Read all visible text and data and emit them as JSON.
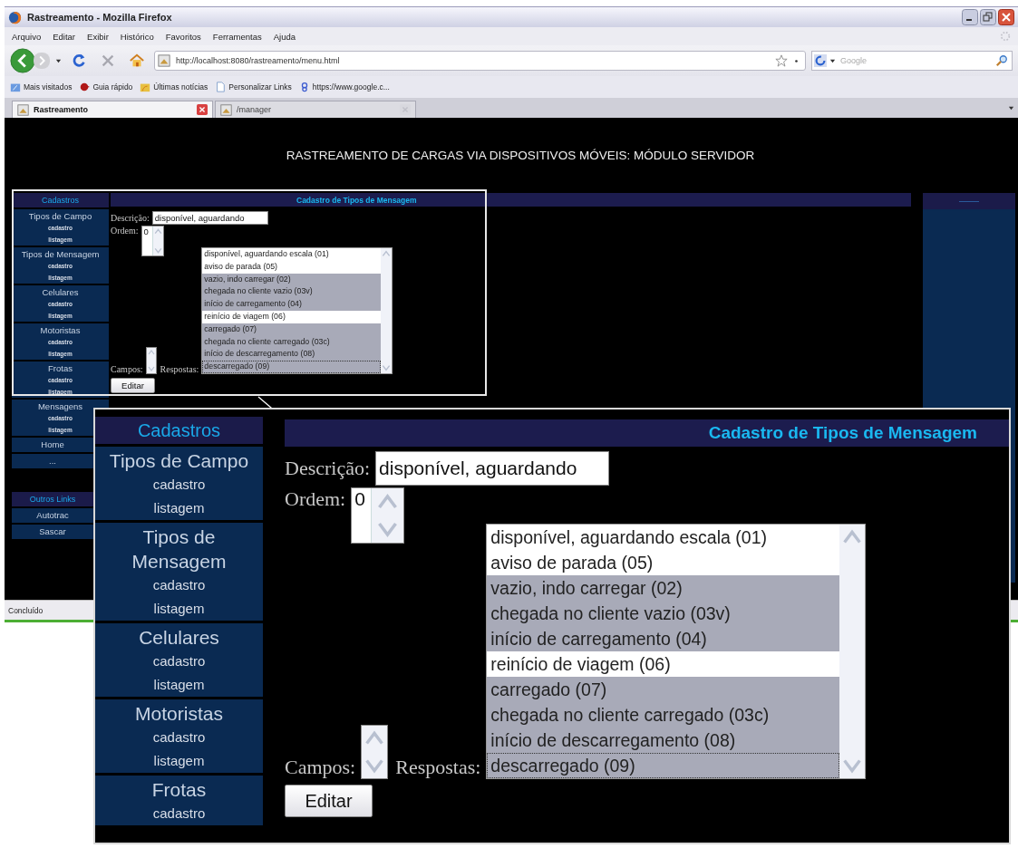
{
  "window": {
    "title": "Rastreamento - Mozilla Firefox"
  },
  "menu": [
    "Arquivo",
    "Editar",
    "Exibir",
    "Histórico",
    "Favoritos",
    "Ferramentas",
    "Ajuda"
  ],
  "navigation": {
    "url": "http://localhost:8080/rastreamento/menu.html",
    "search_placeholder": "Google"
  },
  "bookmarks": [
    {
      "label": "Mais visitados",
      "kind": "smart"
    },
    {
      "label": "Guia rápido",
      "kind": "guide"
    },
    {
      "label": "Últimas notícias",
      "kind": "feed"
    },
    {
      "label": "Personalizar Links",
      "kind": "page"
    },
    {
      "label": "https://www.google.c...",
      "kind": "google"
    }
  ],
  "tabs": [
    {
      "label": "Rastreamento",
      "selected": true
    },
    {
      "label": "/manager",
      "selected": false
    }
  ],
  "page": {
    "header": "RASTREAMENTO DE CARGAS VIA DISPOSITIVOS MÓVEIS: MÓDULO SERVIDOR",
    "sidebar": [
      {
        "kind": "heading",
        "label": "Cadastros"
      },
      {
        "kind": "group",
        "title": "Tipos de Campo",
        "links": [
          "cadastro",
          "listagem"
        ]
      },
      {
        "kind": "group",
        "title": "Tipos de Mensagem",
        "links": [
          "cadastro",
          "listagem"
        ]
      },
      {
        "kind": "group",
        "title": "Celulares",
        "links": [
          "cadastro",
          "listagem"
        ]
      },
      {
        "kind": "group",
        "title": "Motoristas",
        "links": [
          "cadastro",
          "listagem"
        ]
      },
      {
        "kind": "group",
        "title": "Frotas",
        "links": [
          "cadastro",
          "listagem"
        ]
      },
      {
        "kind": "group",
        "title": "Mensagens",
        "links": [
          "cadastro",
          "listagem"
        ]
      },
      {
        "kind": "link",
        "label": "Home"
      },
      {
        "kind": "link",
        "label": "..."
      },
      {
        "kind": "heading",
        "label": "Outros Links"
      },
      {
        "kind": "link",
        "label": "Autotrac"
      },
      {
        "kind": "link",
        "label": "Sascar"
      }
    ],
    "form": {
      "title": "Cadastro de Tipos de Mensagem",
      "description_label": "Descrição:",
      "description_value": "disponível, aguardando",
      "order_label": "Ordem:",
      "order_value": "0",
      "fields_label": "Campos:",
      "answers_label": "Respostas:",
      "answers": [
        {
          "label": "disponível, aguardando escala (01)",
          "selected": false,
          "focused": false
        },
        {
          "label": "aviso de parada (05)",
          "selected": false,
          "focused": false
        },
        {
          "label": "vazio, indo carregar (02)",
          "selected": true,
          "focused": false
        },
        {
          "label": "chegada no cliente vazio (03v)",
          "selected": true,
          "focused": false
        },
        {
          "label": "início de carregamento (04)",
          "selected": true,
          "focused": false
        },
        {
          "label": "reinício de viagem (06)",
          "selected": false,
          "focused": false
        },
        {
          "label": "carregado (07)",
          "selected": true,
          "focused": false
        },
        {
          "label": "chegada no cliente carregado (03c)",
          "selected": true,
          "focused": false
        },
        {
          "label": "início de descarregamento (08)",
          "selected": true,
          "focused": false
        },
        {
          "label": "descarregado (09)",
          "selected": true,
          "focused": true
        }
      ],
      "button": "Editar"
    }
  },
  "status_bar": "Concluído",
  "magnified": {
    "sidebar": [
      {
        "kind": "heading",
        "label": "Cadastros"
      },
      {
        "kind": "group",
        "title": "Tipos de Campo",
        "links": [
          "cadastro",
          "listagem"
        ]
      },
      {
        "kind": "group",
        "title": "Tipos de Mensagem",
        "links": [
          "cadastro",
          "listagem"
        ]
      },
      {
        "kind": "group",
        "title": "Celulares",
        "links": [
          "cadastro",
          "listagem"
        ]
      },
      {
        "kind": "group",
        "title": "Motoristas",
        "links": [
          "cadastro",
          "listagem"
        ]
      },
      {
        "kind": "group",
        "title": "Frotas",
        "links": [
          "cadastro"
        ]
      }
    ],
    "form": {
      "title": "Cadastro de Tipos de Mensagem",
      "description_label": "Descrição:",
      "description_value": "disponível, aguardando",
      "order_label": "Ordem:",
      "order_value": "0",
      "fields_label": "Campos:",
      "answers_label": "Respostas:",
      "answers": [
        {
          "label": "disponível, aguardando escala (01)",
          "selected": false,
          "focused": false
        },
        {
          "label": "aviso de parada (05)",
          "selected": false,
          "focused": false
        },
        {
          "label": "vazio, indo carregar (02)",
          "selected": true,
          "focused": false
        },
        {
          "label": "chegada no cliente vazio (03v)",
          "selected": true,
          "focused": false
        },
        {
          "label": "início de carregamento (04)",
          "selected": true,
          "focused": false
        },
        {
          "label": "reinício de viagem (06)",
          "selected": false,
          "focused": false
        },
        {
          "label": "carregado (07)",
          "selected": true,
          "focused": false
        },
        {
          "label": "chegada no cliente carregado (03c)",
          "selected": true,
          "focused": false
        },
        {
          "label": "início de descarregamento (08)",
          "selected": true,
          "focused": false
        },
        {
          "label": "descarregado (09)",
          "selected": true,
          "focused": true
        }
      ],
      "button": "Editar"
    }
  }
}
